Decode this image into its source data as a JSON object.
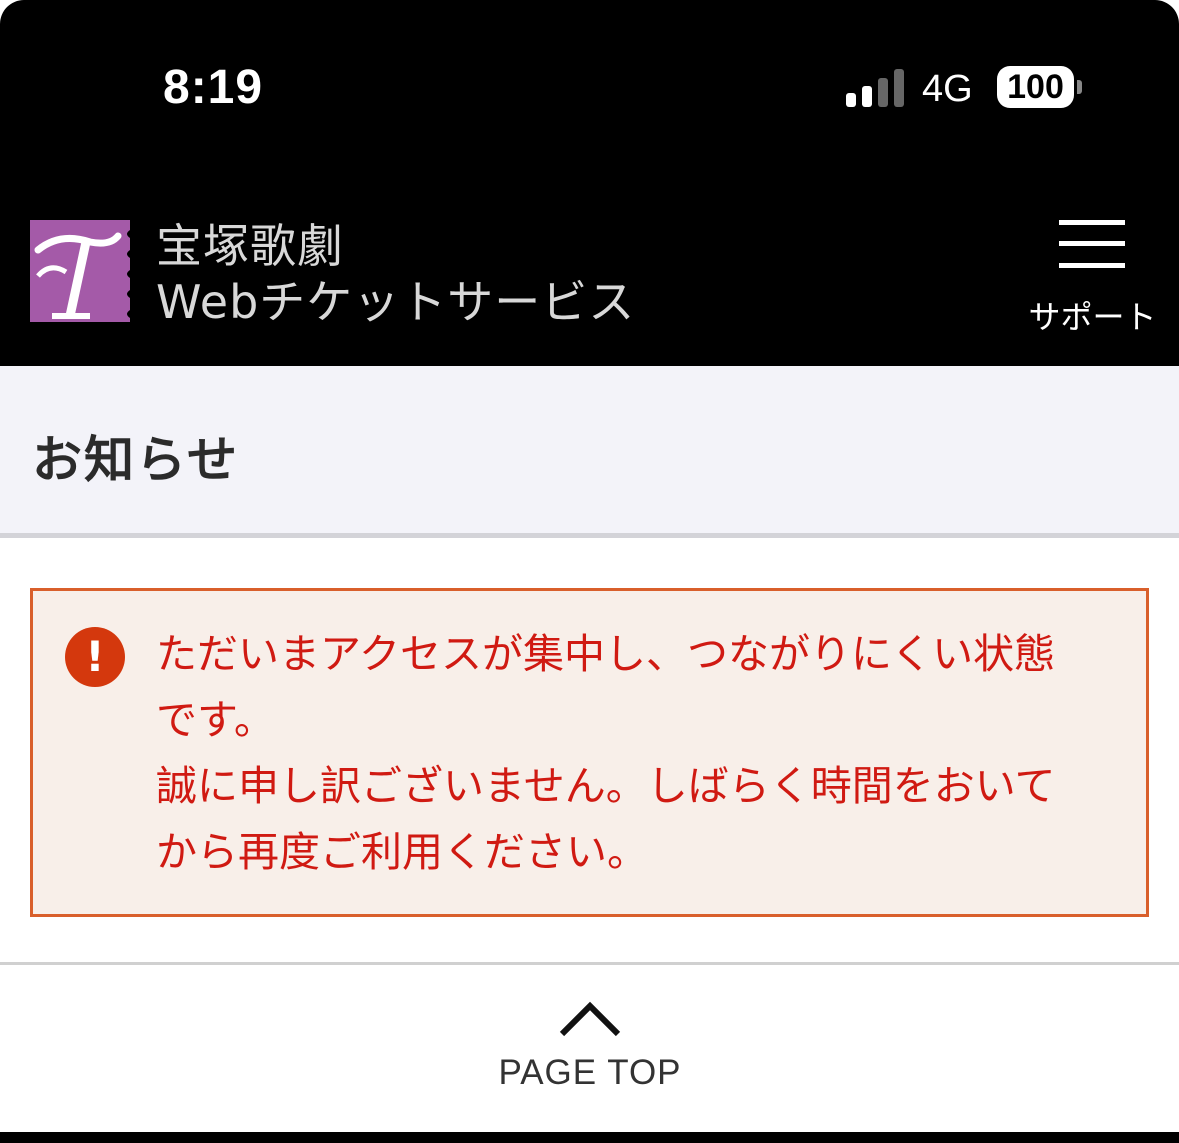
{
  "status_bar": {
    "time": "8:19",
    "network": "4G",
    "battery": "100"
  },
  "header": {
    "logo_line1": "宝塚歌劇",
    "logo_line2": "Webチケットサービス",
    "menu_label": "サポート",
    "logo_color": "#a45aa8"
  },
  "section": {
    "title": "お知らせ"
  },
  "alert": {
    "icon": "exclamation-icon",
    "line1": "ただいまアクセスが集中し、つながりにくい状態\nです。",
    "line2": "誠に申し訳ございません。しばらく時間をおいて\nから再度ご利用ください。",
    "text_color": "#d01a12",
    "border_color": "#d95f2b"
  },
  "footer": {
    "page_top_label": "PAGE TOP"
  }
}
